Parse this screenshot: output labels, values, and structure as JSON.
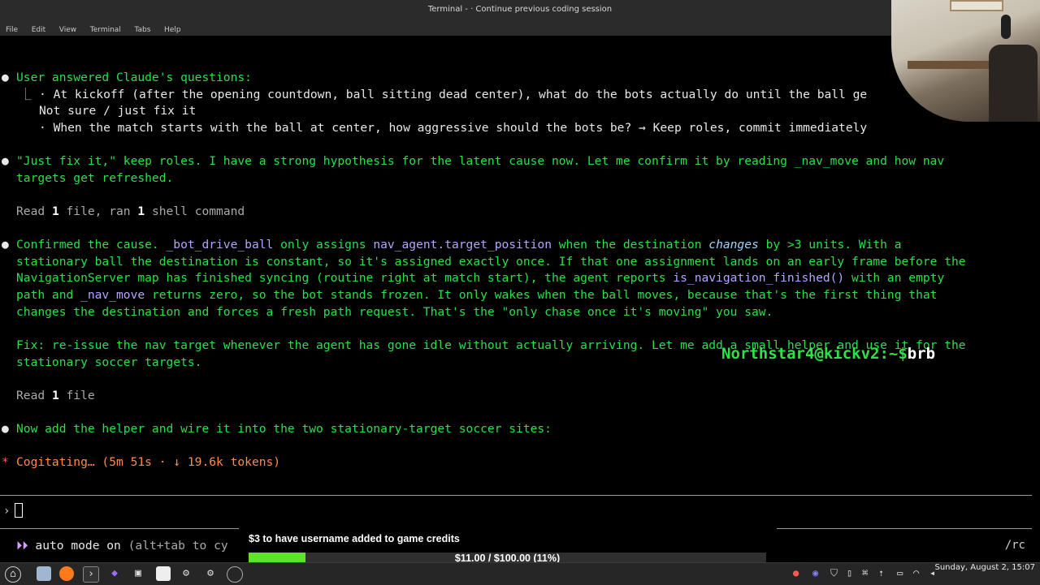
{
  "window": {
    "title": "Terminal - · Continue previous coding session"
  },
  "menu": [
    "File",
    "Edit",
    "View",
    "Terminal",
    "Tabs",
    "Help"
  ],
  "transcript": {
    "l1": "User answered Claude's questions:",
    "l2": "· At kickoff (after the opening countdown, ball sitting dead center), what do the bots actually do until the ball ge",
    "l3": "Not sure / just fix it",
    "l4": "· When the match starts with the ball at center, how aggressive should the bots be? → Keep roles, commit immediately",
    "l5": "\"Just fix it,\" keep roles. I have a strong hypothesis for the latent cause now. Let me confirm it by reading _nav_move and how nav",
    "l6": "targets get refreshed.",
    "l7a": "Read ",
    "l7b": "1",
    "l7c": " file, ran ",
    "l7d": "1",
    "l7e": " shell command",
    "p1a": "Confirmed the cause. ",
    "p1b": "_bot_drive_ball",
    "p1c": " only assigns ",
    "p1d": "nav_agent.target_position",
    "p1e": " when the destination ",
    "p1f": "changes",
    "p1g": " by >3 units. With a",
    "p2": "stationary ball the destination is constant, so it's assigned exactly once. If that one assignment lands on an early frame before the",
    "p3a": "NavigationServer map has finished syncing (routine right at match start), the agent reports ",
    "p3b": "is_navigation_finished()",
    "p3c": " with an empty",
    "p4a": "path and ",
    "p4b": "_nav_move",
    "p4c": " returns zero, so the bot stands frozen. It only wakes when the ball moves, because that's the first thing that",
    "p5": "changes the destination and forces a fresh path request. That's the \"only chase once it's moving\" you saw.",
    "f1": "Fix: re-issue the nav target whenever the agent has gone idle without actually arriving. Let me add a small helper and use it for the",
    "f2": "stationary soccer targets.",
    "r2a": "Read ",
    "r2b": "1",
    "r2c": " file",
    "n1": "Now add the helper and wire it into the two stationary-target soccer sites:",
    "cog_star": "*",
    "cog": "Cogitating… (5m 51s · ↓ 19.6k tokens)",
    "prompt_symbol": "›",
    "auto_arrows": "⏵⏵",
    "auto_on": "auto mode on",
    "auto_rest": " (alt+tab to cy",
    "rc": "/rc"
  },
  "overlay": {
    "user_host": "Northstar4@kickv2:~$",
    "command": "brb"
  },
  "goal": {
    "label": "$3 to have username added to game credits",
    "progress_text": "$11.00 / $100.00 (11%)",
    "fraction": 0.11,
    "fill_color": "#5ee32b"
  },
  "taskbar": {
    "clock": "Sunday, August  2, 15:07",
    "icons": [
      "menu-icon",
      "files-icon",
      "firefox-icon",
      "terminal-icon",
      "obsidian-icon",
      "app-icon",
      "document-icon",
      "gear-icon",
      "gear-icon",
      "chrome-icon"
    ]
  },
  "colors": {
    "green": "#28e04a",
    "purple": "#b7a4ff",
    "background": "#000000"
  }
}
